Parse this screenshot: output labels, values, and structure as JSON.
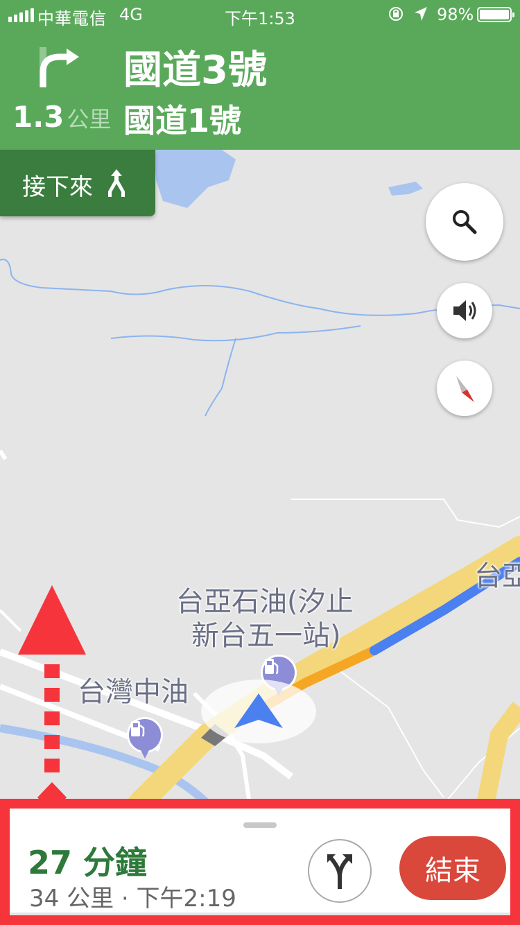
{
  "status_bar": {
    "carrier": "中華電信",
    "network": "4G",
    "time": "下午1:53",
    "battery": "98%"
  },
  "navigation": {
    "turn_icon": "turn-right-icon",
    "distance_value": "1.3",
    "distance_unit": "公里",
    "road_primary": "國道3號",
    "road_secondary": "國道1號",
    "then_label": "接下來",
    "then_icon": "merge-icon"
  },
  "map": {
    "labels": {
      "poi_taiya_line1": "台亞石油(汐止",
      "poi_taiya_line2": "新台五一站)",
      "poi_cpc": "台灣中油",
      "edge_label": "台亞"
    },
    "poi_icon": "gas-station-icon"
  },
  "controls": {
    "search_icon": "search-icon",
    "sound_icon": "volume-icon",
    "compass_icon": "compass-icon"
  },
  "trip": {
    "duration": "27 分鐘",
    "detail": "34 公里 · 下午2:19",
    "routes_icon": "alternate-routes-icon",
    "exit_label": "結束"
  },
  "colors": {
    "header_green": "#5aa95b",
    "then_green": "#3b7d3f",
    "route_blue": "#4a80f0",
    "traffic_orange": "#f5a623",
    "exit_red": "#d9483b",
    "annotation_red": "#f5343c"
  }
}
